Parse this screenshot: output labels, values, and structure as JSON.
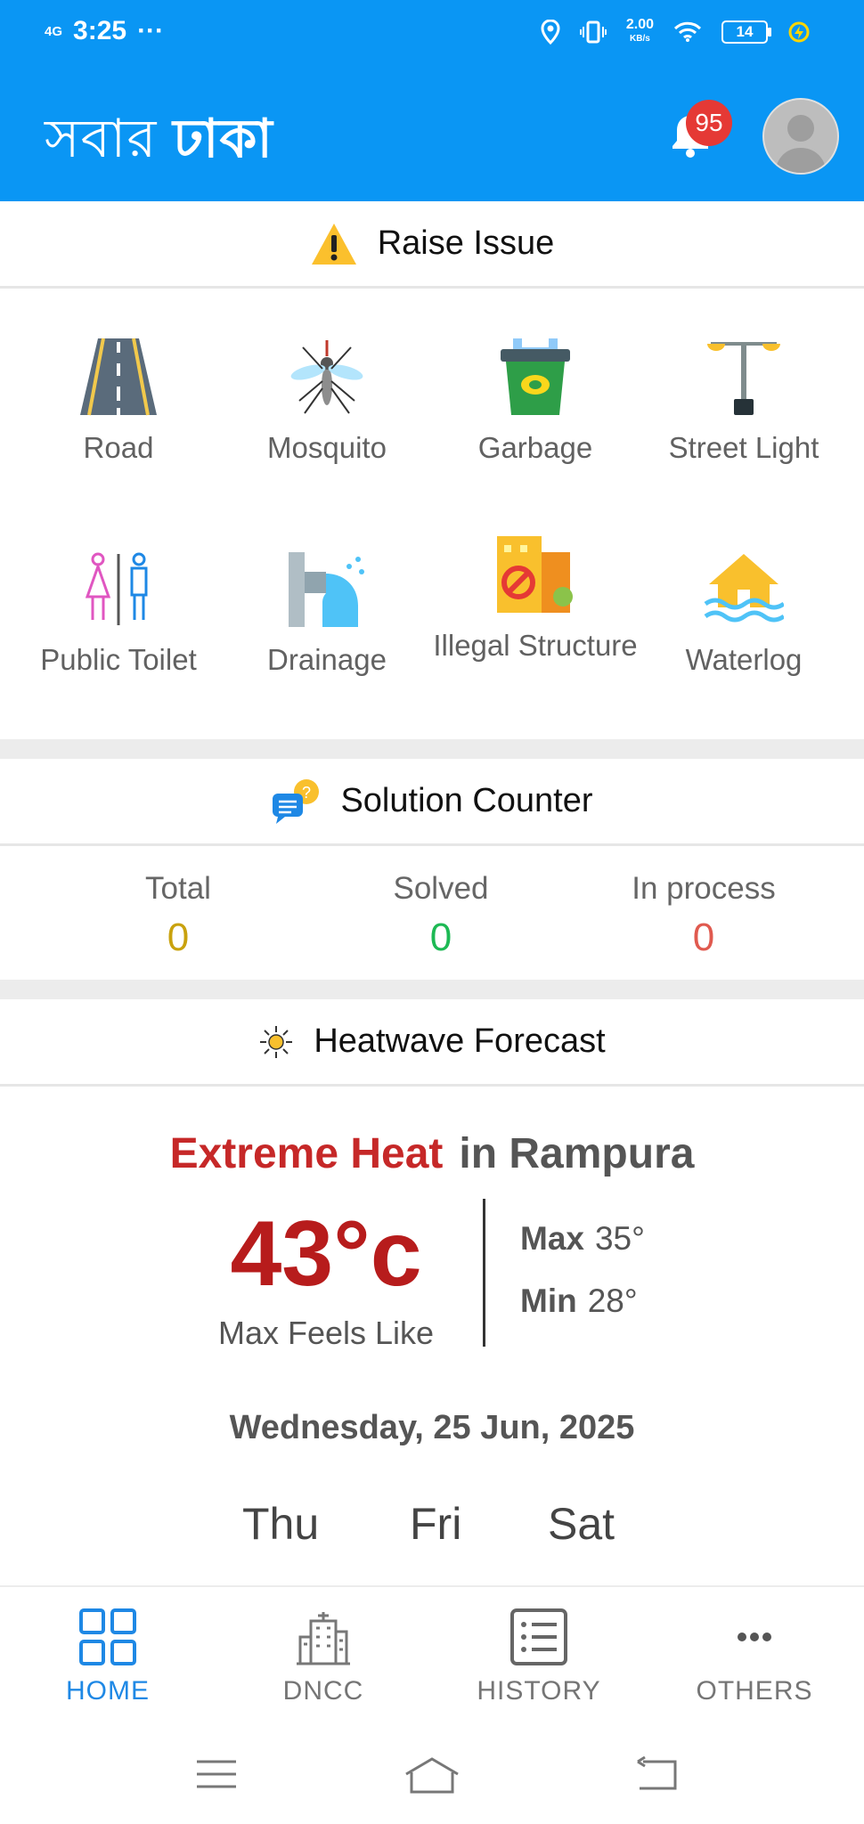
{
  "status_bar": {
    "network": "4G",
    "time": "3:25",
    "more": "···",
    "speed_value": "2.00",
    "speed_unit": "KB/s",
    "battery": "14"
  },
  "header": {
    "logo_part1": "সবার",
    "logo_part2": "ঢাকা",
    "notification_count": "95"
  },
  "raise_issue": {
    "title": "Raise Issue",
    "items": [
      {
        "label": "Road",
        "icon": "road-icon"
      },
      {
        "label": "Mosquito",
        "icon": "mosquito-icon"
      },
      {
        "label": "Garbage",
        "icon": "garbage-icon"
      },
      {
        "label": "Street Light",
        "icon": "street-light-icon"
      },
      {
        "label": "Public Toilet",
        "icon": "toilet-icon"
      },
      {
        "label": "Drainage",
        "icon": "drainage-icon"
      },
      {
        "label": "Illegal Structure",
        "icon": "illegal-structure-icon"
      },
      {
        "label": "Waterlog",
        "icon": "waterlog-icon"
      }
    ]
  },
  "solution_counter": {
    "title": "Solution Counter",
    "items": [
      {
        "label": "Total",
        "value": "0",
        "color": "#c9a20e"
      },
      {
        "label": "Solved",
        "value": "0",
        "color": "#1db954"
      },
      {
        "label": "In process",
        "value": "0",
        "color": "#e05a4f"
      }
    ]
  },
  "heatwave": {
    "title": "Heatwave Forecast",
    "alert": "Extreme Heat",
    "location_text": "in Rampura",
    "temperature": "43°c",
    "temperature_label": "Max Feels Like",
    "max_label": "Max",
    "max_value": "35°",
    "min_label": "Min",
    "min_value": "28°",
    "date": "Wednesday, 25 Jun, 2025",
    "days": [
      "Thu",
      "Fri",
      "Sat"
    ]
  },
  "bottom_nav": {
    "items": [
      {
        "label": "HOME",
        "icon": "home-grid-icon",
        "active": true
      },
      {
        "label": "DNCC",
        "icon": "building-icon",
        "active": false
      },
      {
        "label": "HISTORY",
        "icon": "list-icon",
        "active": false
      },
      {
        "label": "OTHERS",
        "icon": "more-icon",
        "active": false
      }
    ]
  },
  "colors": {
    "primary": "#0a96f4",
    "alert_red": "#c62828",
    "nav_active": "#1e88e5"
  }
}
